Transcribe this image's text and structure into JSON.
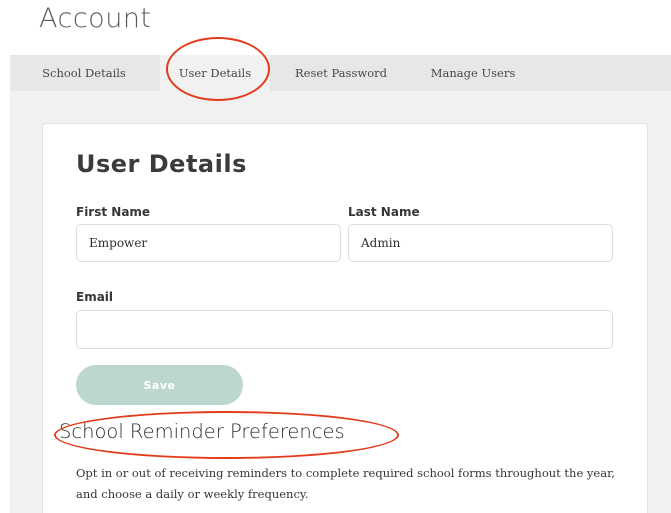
{
  "header": {
    "title": "Account"
  },
  "tabs": [
    {
      "label": "School Details",
      "active": false
    },
    {
      "label": "User Details",
      "active": true
    },
    {
      "label": "Reset Password",
      "active": false
    },
    {
      "label": "Manage Users",
      "active": false
    }
  ],
  "form": {
    "heading": "User Details",
    "first_name": {
      "label": "First Name",
      "value": "Empower"
    },
    "last_name": {
      "label": "Last Name",
      "value": "Admin"
    },
    "email": {
      "label": "Email",
      "value": ""
    },
    "save_label": "Save"
  },
  "reminders": {
    "heading": "School Reminder Preferences",
    "description": "Opt in or out of receiving reminders to complete required school forms throughout the year, and choose a daily or weekly frequency."
  },
  "colors": {
    "annotation": "#e23c1b",
    "save_button": "#bcd7cd",
    "tab_bar": "#e6e8e8",
    "content_background": "#f1f1f1"
  }
}
